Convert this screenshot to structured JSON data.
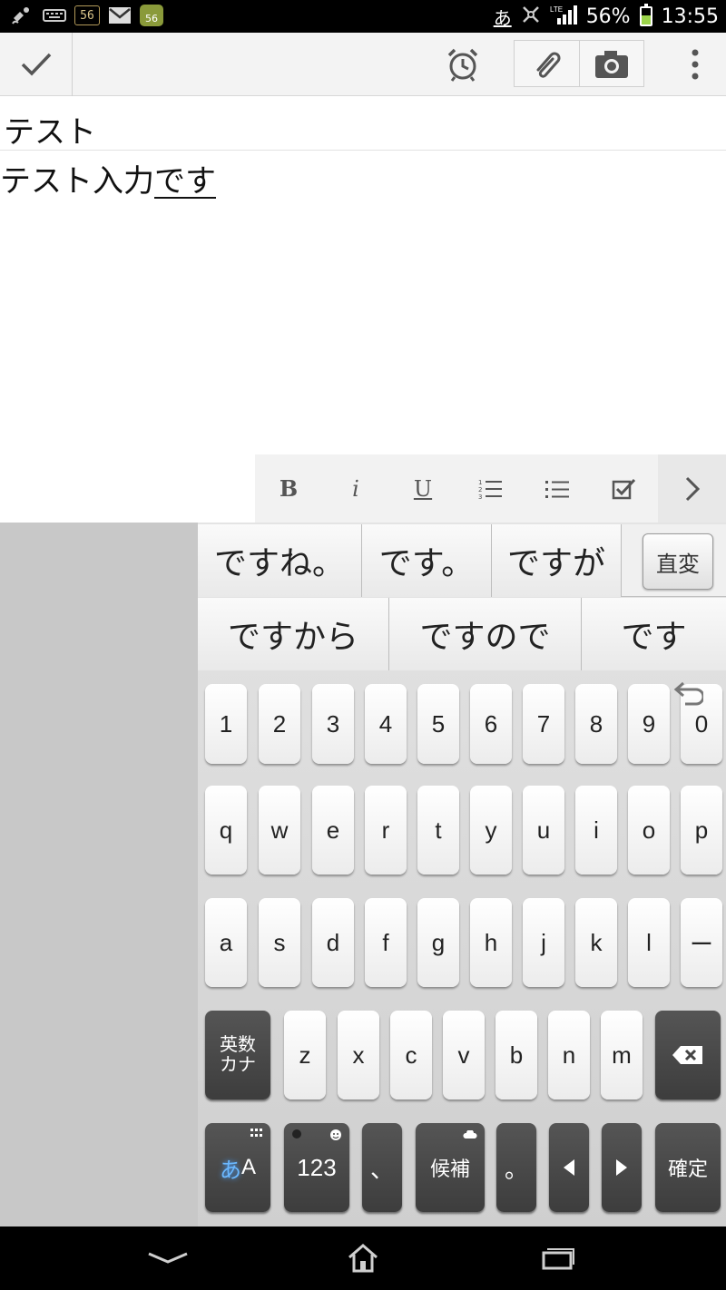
{
  "status_bar": {
    "left_icons": [
      "satellite-icon",
      "keyboard-icon",
      "sim-56-icon",
      "gmail-icon",
      "android-update-icon"
    ],
    "sim_label": "56",
    "android_label": "56",
    "ime_indicator": "あ",
    "battery_percent": "56%",
    "battery_level": 0.56,
    "time": "13:55"
  },
  "action_bar": {
    "icons": [
      "check-icon",
      "alarm-clock-icon",
      "paperclip-icon",
      "camera-icon",
      "overflow-menu-icon"
    ]
  },
  "note": {
    "title": "テスト",
    "body_committed": "テスト入力",
    "body_composing": "です"
  },
  "format_toolbar": {
    "bold": "B",
    "italic": "i",
    "underline": "U",
    "icons": [
      "numbered-list-icon",
      "bullet-list-icon",
      "checkbox-icon",
      "chevron-right-icon"
    ]
  },
  "candidates": {
    "row1": [
      "ですね。",
      "です。",
      "ですが"
    ],
    "convert": "直変",
    "row2": [
      "ですから",
      "ですので",
      "です"
    ]
  },
  "keyboard": {
    "row_numbers": [
      "1",
      "2",
      "3",
      "4",
      "5",
      "6",
      "7",
      "8",
      "9",
      "0"
    ],
    "row_qwerty": [
      "q",
      "w",
      "e",
      "r",
      "t",
      "y",
      "u",
      "i",
      "o",
      "p"
    ],
    "row_asdf": [
      "a",
      "s",
      "d",
      "f",
      "g",
      "h",
      "j",
      "k",
      "l",
      "ー"
    ],
    "row_zxcv": [
      "z",
      "x",
      "c",
      "v",
      "b",
      "n",
      "m"
    ],
    "eisu_kana_top": "英数",
    "eisu_kana_bottom": "カナ",
    "mode_kana": "あ",
    "mode_alpha": "A",
    "num_key": "123",
    "comma": "、",
    "candidates_key": "候補",
    "period": "。",
    "confirm": "確定"
  },
  "nav_bar": {
    "icons": [
      "back-icon",
      "home-icon",
      "recent-apps-icon"
    ]
  }
}
